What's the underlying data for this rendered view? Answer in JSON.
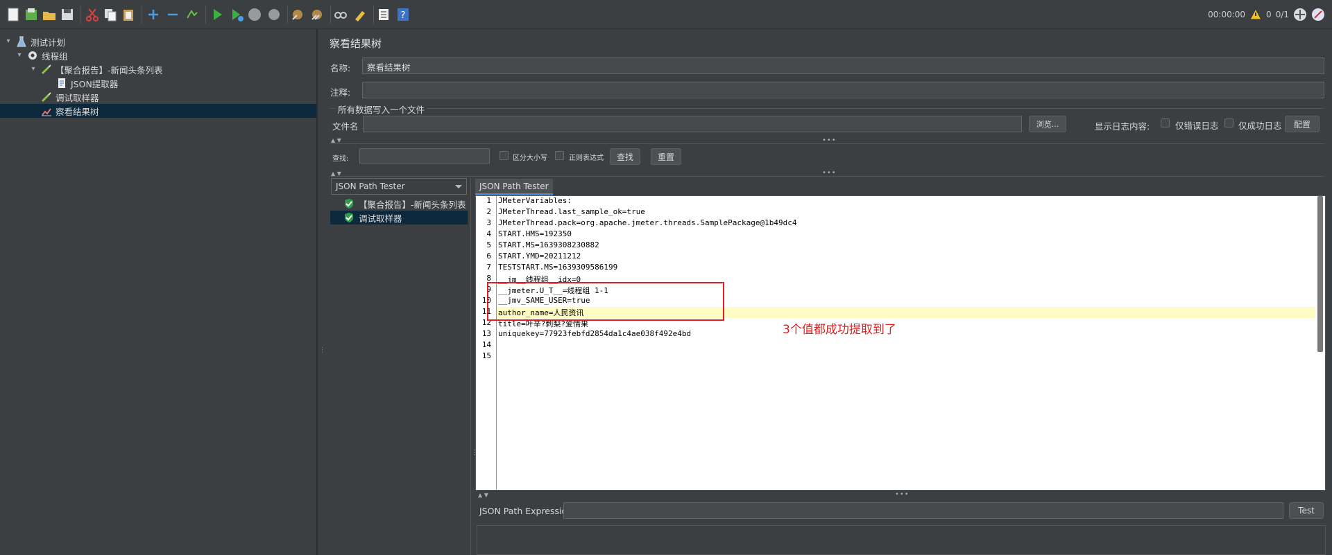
{
  "toolbar": {
    "timer": "00:00:00",
    "warnings": "0",
    "threads": "0/1"
  },
  "tree": {
    "items": [
      {
        "label": "测试计划"
      },
      {
        "label": "线程组"
      },
      {
        "label": "【聚合报告】-新闻头条列表"
      },
      {
        "label": "JSON提取器"
      },
      {
        "label": "调试取样器"
      },
      {
        "label": "察看结果树"
      }
    ]
  },
  "panel": {
    "title": "察看结果树",
    "name_label": "名称:",
    "name_value": "察看结果树",
    "comment_label": "注释:",
    "comment_value": "",
    "file_section_title": "所有数据写入一个文件",
    "filename_label": "文件名",
    "filename_value": "",
    "browse_label": "浏览...",
    "log_content_label": "显示日志内容:",
    "errors_only_label": "仅错误日志",
    "success_only_label": "仅成功日志",
    "configure_label": "配置",
    "search_label": "查找:",
    "search_value": "",
    "case_sensitive_label": "区分大小写",
    "regex_label": "正则表达式",
    "find_label": "查找",
    "reset_label": "重置"
  },
  "renderer": {
    "selected": "JSON Path Tester"
  },
  "results": [
    {
      "label": "【聚合报告】-新闻头条列表"
    },
    {
      "label": "调试取样器"
    }
  ],
  "tab": {
    "label": "JSON Path Tester"
  },
  "editor": {
    "lines": [
      "JMeterVariables:",
      "JMeterThread.last_sample_ok=true",
      "JMeterThread.pack=org.apache.jmeter.threads.SamplePackage@1b49dc4",
      "START.HMS=192350",
      "START.MS=1639308230882",
      "START.YMD=20211212",
      "TESTSTART.MS=1639309586199",
      "__jm__线程组__idx=0",
      "__jmeter.U_T__=线程组 1-1",
      "__jmv_SAME_USER=true",
      "author_name=人民资讯",
      "title=叶辛?刺梨?爱情果",
      "uniquekey=77923febfd2854da1c4ae038f492e4bd",
      "",
      ""
    ],
    "line_numbers": [
      "1",
      "2",
      "3",
      "4",
      "5",
      "6",
      "7",
      "8",
      "9",
      "10",
      "11",
      "12",
      "13",
      "14",
      "15"
    ],
    "highlight_line": 11,
    "annotation": "3个值都成功提取到了"
  },
  "expression": {
    "label": "JSON Path Expression",
    "value": "",
    "test_label": "Test"
  },
  "colors": {
    "background": "#3c3f41",
    "selection": "#0d293e",
    "annotation": "#e02020",
    "highlight": "#fefcc3"
  }
}
